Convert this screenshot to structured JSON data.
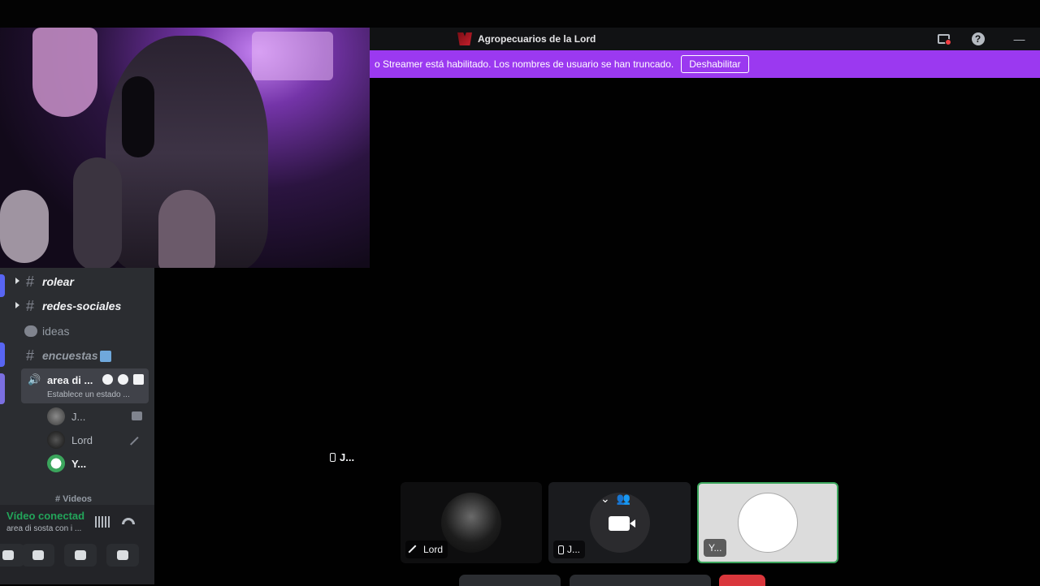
{
  "window": {
    "title": "Agropecuarios de la Lord",
    "help_glyph": "?",
    "minimize_glyph": "—"
  },
  "notice": {
    "text": "o Streamer está habilitado. Los nombres de usuario se han truncado.",
    "button_label": "Deshabilitar"
  },
  "sidebar": {
    "channels": [
      {
        "label": "rolear",
        "glyph": "#"
      },
      {
        "label": "redes-sociales",
        "glyph": "#"
      },
      {
        "label": "ideas"
      },
      {
        "label": "encuestas",
        "glyph": "#"
      }
    ],
    "voice_channel": {
      "name": "area di ...",
      "status": "Establece un estado ..."
    },
    "members": [
      {
        "name": "J..."
      },
      {
        "name": "Lord"
      },
      {
        "name": "Y..."
      }
    ],
    "videos_label": "# Videos"
  },
  "connection": {
    "status": "Vídeo conectado",
    "channel": "area di sosta con i ..."
  },
  "stage": {
    "floating_user": "J...",
    "tiles": [
      {
        "label": "Lord"
      },
      {
        "label": "J..."
      },
      {
        "label": "Y..."
      }
    ]
  },
  "colors": {
    "accent_purple": "#9b39f0",
    "connected_green": "#23a55a",
    "danger_red": "#f23f43"
  }
}
